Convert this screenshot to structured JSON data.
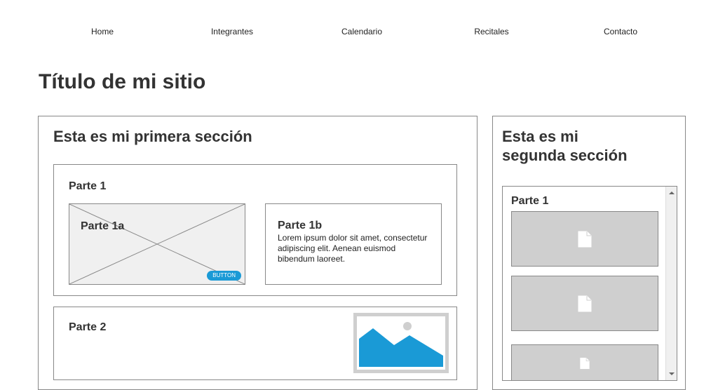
{
  "nav": {
    "items": [
      {
        "label": "Home"
      },
      {
        "label": "Integrantes"
      },
      {
        "label": "Calendario"
      },
      {
        "label": "Recitales"
      },
      {
        "label": "Contacto"
      }
    ]
  },
  "site_title": "Título de mi sitio",
  "section1": {
    "title": "Esta es mi primera sección",
    "parte1": {
      "title": "Parte 1",
      "parte1a": {
        "title": "Parte 1a",
        "button": "BUTTON"
      },
      "parte1b": {
        "title": "Parte 1b",
        "text": "Lorem ipsum dolor sit amet, consectetur adipiscing elit. Aenean euismod bibendum laoreet."
      }
    },
    "parte2": {
      "title": "Parte 2",
      "image_icon": "landscape-image-icon"
    }
  },
  "section2": {
    "title_line1": "Esta es mi",
    "title_line2": "segunda sección",
    "parte1": {
      "title": "Parte 1",
      "file_icon": "file-icon"
    }
  },
  "colors": {
    "accent": "#1a9ad6",
    "placeholder": "#cfcfcf",
    "border": "#888888"
  }
}
